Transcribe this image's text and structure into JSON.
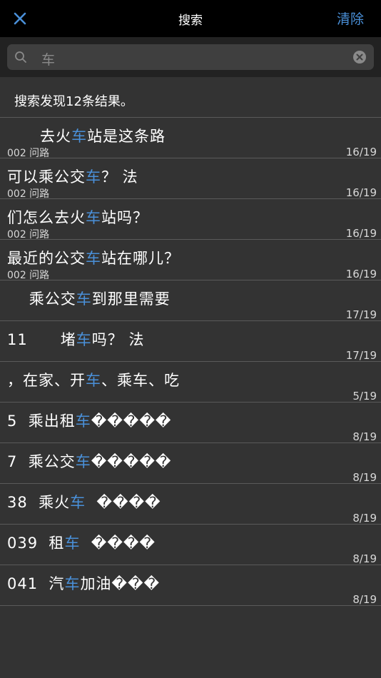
{
  "navbar": {
    "title": "搜索",
    "clear_label": "清除",
    "close_icon": "close-icon"
  },
  "search": {
    "value": "车",
    "search_icon": "search-icon",
    "clear_icon": "clear-input-icon"
  },
  "summary": "搜索发现12条结果。",
  "accent_color": "#4a90d9",
  "results": [
    {
      "pre": "      去火",
      "hl": "车",
      "post": "站是这条路",
      "sub": "002 问路",
      "page": "16/19"
    },
    {
      "pre": "可以乘公交",
      "hl": "车",
      "post": "？ 法",
      "sub": "002 问路",
      "page": "16/19"
    },
    {
      "pre": "们怎么去火",
      "hl": "车",
      "post": "站吗？",
      "sub": "002 问路",
      "page": "16/19"
    },
    {
      "pre": "最近的公交",
      "hl": "车",
      "post": "站在哪儿？",
      "sub": "002 问路",
      "page": "16/19"
    },
    {
      "pre": "    乘公交",
      "hl": "车",
      "post": "到那里需要",
      "sub": "",
      "page": "17/19"
    },
    {
      "pre": "11      堵",
      "hl": "车",
      "post": "吗？ 法",
      "sub": "",
      "page": "17/19"
    },
    {
      "pre": "，在家、开",
      "hl": "车",
      "post": "、乘车、吃",
      "sub": "",
      "page": "5/19"
    },
    {
      "pre": "5  乘出租",
      "hl": "车",
      "post": "�����",
      "sub": "",
      "page": "8/19"
    },
    {
      "pre": "7  乘公交",
      "hl": "车",
      "post": "�����",
      "sub": "",
      "page": "8/19"
    },
    {
      "pre": "38  乘火",
      "hl": "车",
      "post": "  ����",
      "sub": "",
      "page": "8/19"
    },
    {
      "pre": "039  租",
      "hl": "车",
      "post": "  ����",
      "sub": "",
      "page": "8/19"
    },
    {
      "pre": "041  汽",
      "hl": "车",
      "post": "加油���",
      "sub": "",
      "page": "8/19"
    }
  ]
}
